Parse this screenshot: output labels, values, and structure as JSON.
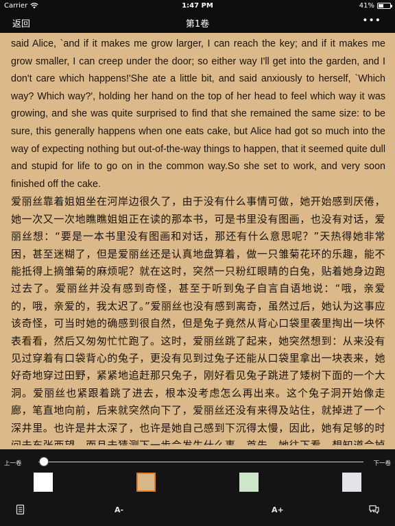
{
  "status_bar": {
    "carrier": "Carrier",
    "time": "1:47 PM",
    "battery": "41%",
    "battery_level": 0.41,
    "wifi_icon": "wifi-icon"
  },
  "nav": {
    "back_label": "返回",
    "title": "第1卷",
    "more_label": "•••"
  },
  "content": {
    "english_paragraph": "said Alice, `and if it makes me grow larger, I can reach the key; and if it makes me grow smaller, I can creep under the door; so either way I'll get into the garden, and I don't care which happens!'She ate a little bit, and said anxiously to herself, `Which way? Which way?', holding her hand on the top of her head to feel which way it was growing, and she was quite surprised to find that she remained the same size: to be sure, this generally happens when one eats cake, but Alice had got so much into the way of expecting nothing but out-of-the-way things to happen, that it seemed quite dull and stupid for life to go on in the common way.So she set to work, and very soon finished off the cake.",
    "chinese_paragraph": "爱丽丝靠着姐姐坐在河岸边很久了，由于没有什么事情可做，她开始感到厌倦，她一次又一次地瞧瞧姐姐正在读的那本书，可是书里没有图画，也没有对话，爱丽丝想：“要是一本书里没有图画和对话，那还有什么意思呢？”天热得她非常困，甚至迷糊了，但是爱丽丝还是认真地盘算着，做一只雏菊花环的乐趣，能不能抵得上摘雏菊的麻烦呢？就在这时，突然一只粉红眼睛的白兔，贴着她身边跑过去了。爱丽丝并没有感到奇怪，甚至于听到兔子自言自语地说：“哦，亲爱的，哦，亲爱的，我太迟了。”爱丽丝也没有感到离奇，虽然过后，她认为这事应该奇怪，可当时她的确感到很自然，但是兔子竟然从背心口袋里袭里掏出一块怀表看看，然后又匆匆忙忙跑了。这时，爱丽丝跳了起来，她突然想到：从来没有见过穿着有口袋背心的兔子，更没有见到过兔子还能从口袋里拿出一块表来，她好奇地穿过田野，紧紧地追赶那只兔子，刚好看见兔子跳进了矮树下面的一个大洞。爱丽丝也紧跟着跳了进去，根本没考虑怎么再出来。这个兔子洞开始像走廊，笔直地向前，后来就突然向下了，爱丽丝还没有来得及站住，就掉进了一个深井里。也许是井太深了，也许是她自己感到下沉得太慢，因此，她有足够的时间去东张西望，而且去猜测下一步会发生什么事，首先，她往下看，想知道会掉到什"
  },
  "controls": {
    "prev_chapter": "上一卷",
    "next_chapter": "下一卷",
    "progress": 0.0,
    "themes": [
      {
        "name": "white",
        "color": "#ffffff",
        "selected": false
      },
      {
        "name": "tan",
        "color": "#d8b786",
        "selected": true
      },
      {
        "name": "green",
        "color": "#cde5c9",
        "selected": false
      },
      {
        "name": "gray",
        "color": "#e4e3e8",
        "selected": false
      }
    ],
    "font_decrease": "A-",
    "font_increase": "A+",
    "catalog_icon": "catalog-icon",
    "comment_icon": "comment-icon"
  },
  "colors": {
    "background": "#dcb98a",
    "bars": "#0e0e0e",
    "accent": "#e37d22"
  }
}
